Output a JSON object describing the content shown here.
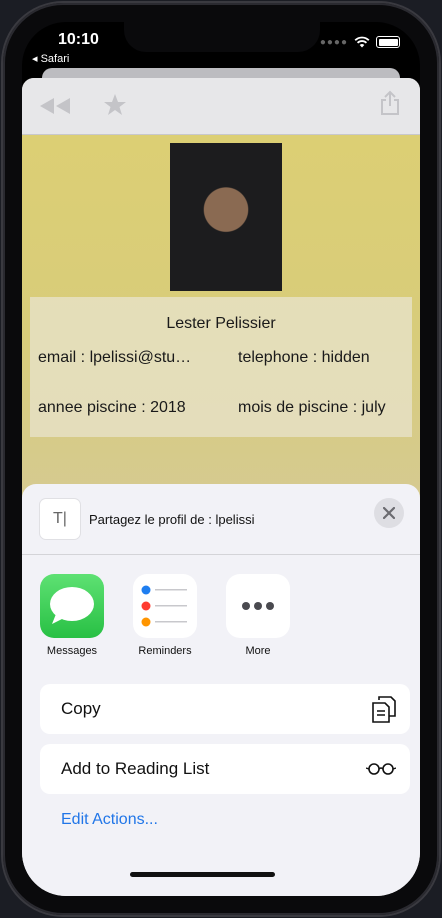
{
  "status_bar": {
    "time": "10:10",
    "back_app": "◂ Safari"
  },
  "profile": {
    "name": "Lester Pelissier",
    "email_field": "email : lpelissi@stu…",
    "telephone_field": "telephone : hidden",
    "annee_field": "annee piscine : 2018",
    "mois_field": "mois de piscine : july"
  },
  "share_sheet": {
    "title": "Partagez le profil de : lpelissi",
    "apps": [
      {
        "label": "Messages",
        "icon": "messages-icon"
      },
      {
        "label": "Reminders",
        "icon": "reminders-icon"
      },
      {
        "label": "More",
        "icon": "more-icon"
      }
    ],
    "actions": [
      {
        "label": "Copy",
        "icon": "copy-icon"
      },
      {
        "label": "Add to Reading List",
        "icon": "glasses-icon"
      }
    ],
    "edit_actions": "Edit Actions..."
  },
  "colors": {
    "accent": "#2176e8",
    "messages_green": "#34c759",
    "page_background_top": "#dccf74",
    "sheet_background": "#f2f2f7"
  }
}
